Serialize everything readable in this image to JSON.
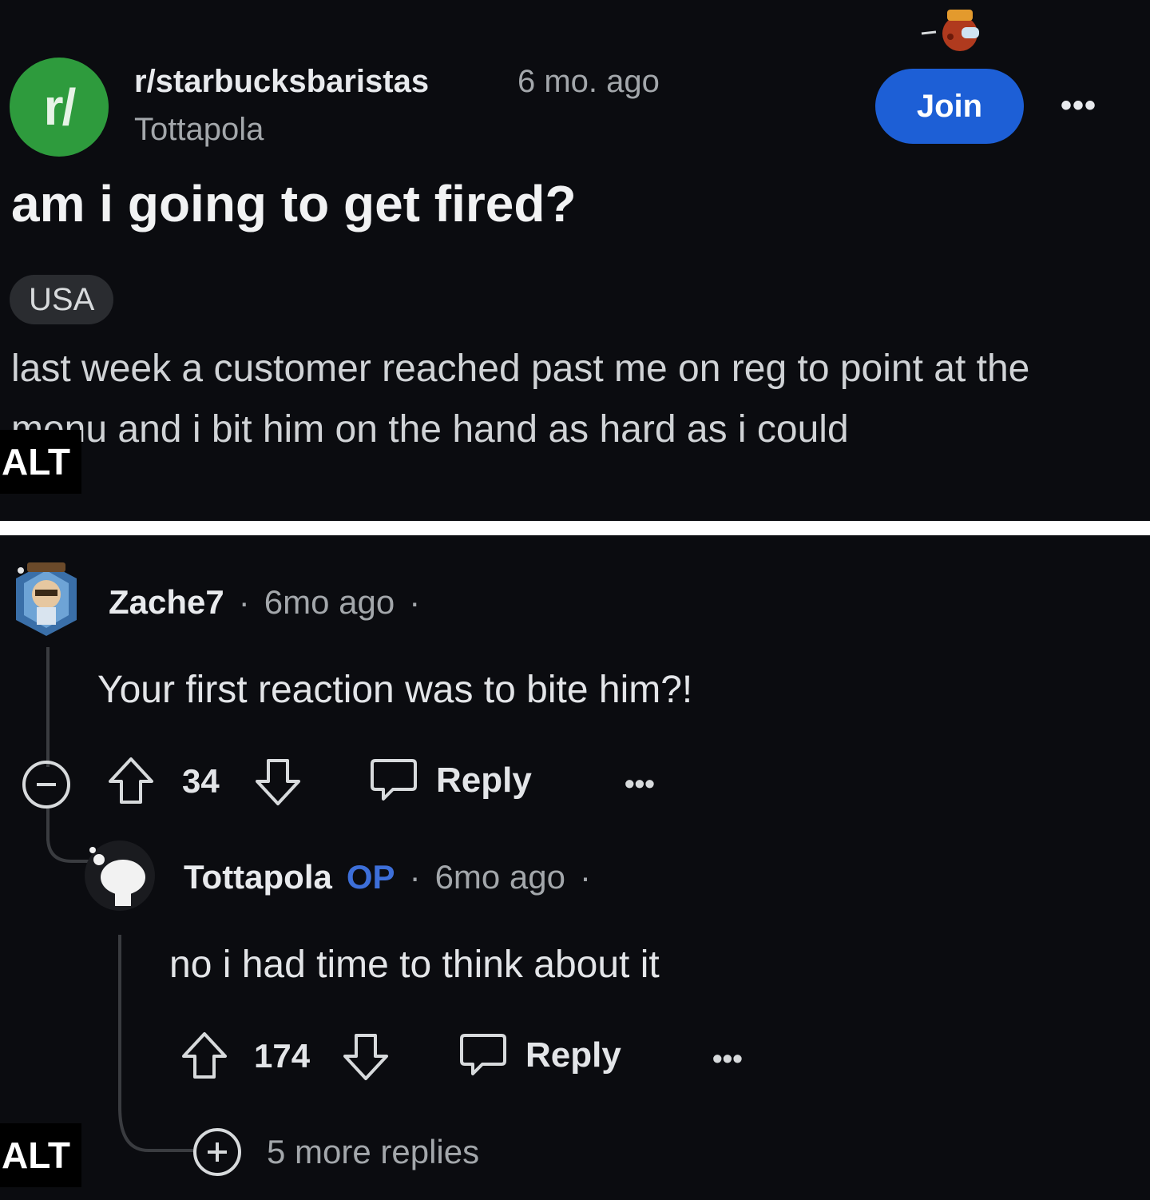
{
  "post": {
    "subreddit_icon": "r/",
    "subreddit": "r/starbucksbaristas",
    "time": "6 mo. ago",
    "author": "Tottapola",
    "join_label": "Join",
    "more_icon": "•••",
    "title": "am i going to get fired?",
    "flair": "USA",
    "body": "last week a customer reached past me on reg to point at the menu and i bit him on the hand as hard as i could",
    "alt_label": "ALT",
    "colors": {
      "join": "#1d5fd6",
      "subreddit_icon": "#2e9b3d",
      "background": "#0b0c10"
    }
  },
  "comments": [
    {
      "user": "Zache7",
      "meta_sep": "·",
      "time": "6mo ago",
      "text": "Your first reaction was to bite him?!",
      "votes": "34",
      "reply_label": "Reply",
      "more_icon": "•••"
    },
    {
      "user": "Tottapola",
      "op_badge": "OP",
      "meta_sep": "·",
      "time": "6mo ago",
      "text": "no i had time to think about it",
      "votes": "174",
      "reply_label": "Reply",
      "more_icon": "•••"
    }
  ],
  "more_replies": "5 more replies",
  "alt_label": "ALT",
  "icons": [
    "collapse-icon",
    "upvote-icon",
    "downvote-icon",
    "comment-icon",
    "expand-icon"
  ]
}
